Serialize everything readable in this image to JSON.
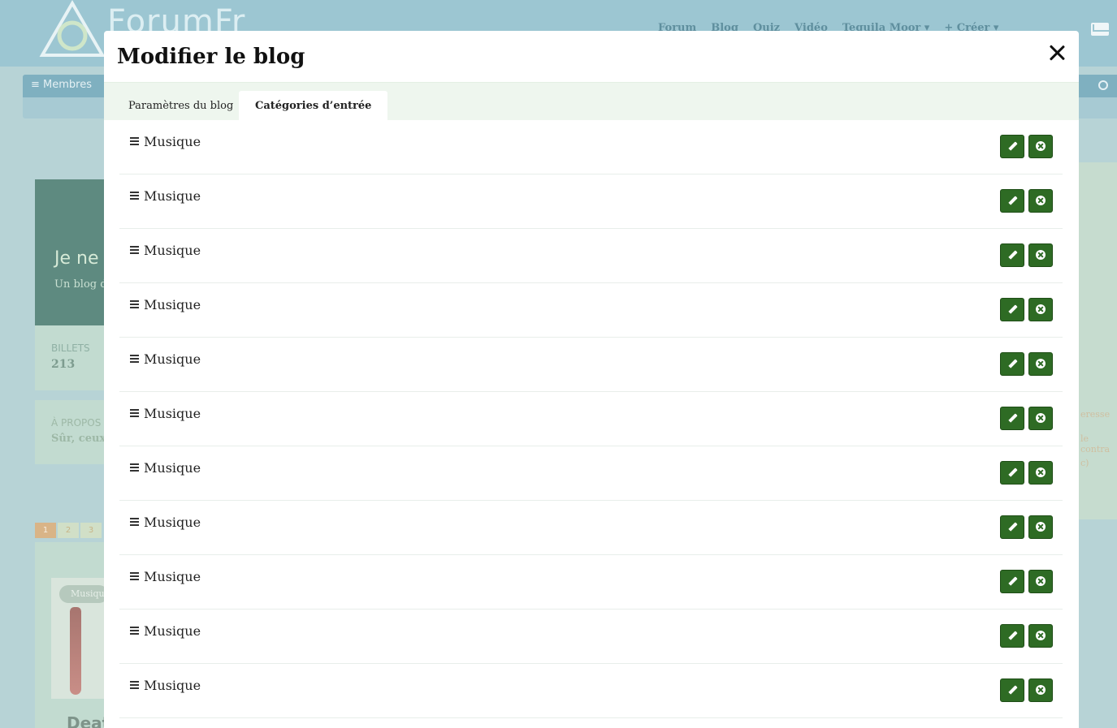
{
  "background": {
    "brand": "ForumFr",
    "nav": [
      "Forum",
      "Blog",
      "Quiz",
      "Vidéo",
      "Tequila Moor ▾",
      "+ Créer ▾"
    ],
    "members_label": "≡ Membres",
    "blog_title_fragment": "Je ne s",
    "blog_subtitle_fragment": "Un blog de",
    "stats_label": "BILLETS",
    "stats_value": "213",
    "about_label": "À PROPOS",
    "about_text_fragment": "Sûr, ceux d",
    "pages": [
      "1",
      "2",
      "3"
    ],
    "post_tag": "Musique",
    "post_title_fragment": "Deat",
    "right_fragments": [
      "eresse",
      "le contra",
      "c)"
    ]
  },
  "modal": {
    "title": "Modifier le blog",
    "tabs": [
      {
        "label": "Paramètres du blog",
        "active": false
      },
      {
        "label": "Catégories d’entrée",
        "active": true
      }
    ],
    "categories": [
      {
        "name": "Musique"
      },
      {
        "name": "Musique"
      },
      {
        "name": "Musique"
      },
      {
        "name": "Musique"
      },
      {
        "name": "Musique"
      },
      {
        "name": "Musique"
      },
      {
        "name": "Musique"
      },
      {
        "name": "Musique"
      },
      {
        "name": "Musique"
      },
      {
        "name": "Musique"
      },
      {
        "name": "Musique"
      }
    ]
  },
  "colors": {
    "accent_button": "#2e6b24",
    "tab_bar": "#eef6ee",
    "overlay_bg": "#b7d3d6"
  },
  "icons": {
    "close": "close-icon",
    "handle": "drag-handle-icon",
    "edit": "pencil-icon",
    "delete": "x-circle-icon"
  }
}
